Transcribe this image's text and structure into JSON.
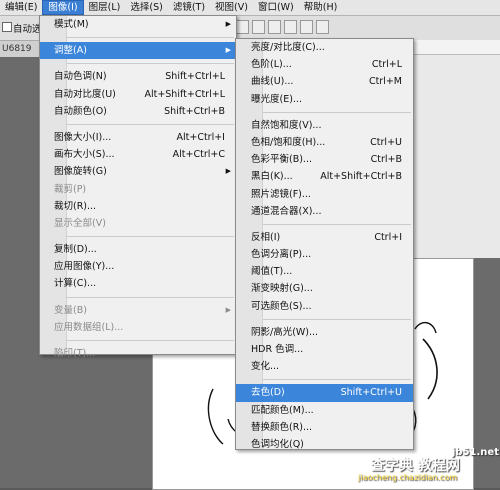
{
  "menubar": {
    "items": [
      "编辑(E)",
      "图像(I)",
      "图层(L)",
      "选择(S)",
      "滤镜(T)",
      "视图(V)",
      "窗口(W)",
      "帮助(H)"
    ],
    "active_index": 1
  },
  "options_bar": {
    "auto_select_label": "自动选"
  },
  "tab": {
    "doc_label": "U6819"
  },
  "image_menu": {
    "items": [
      {
        "type": "item",
        "label": "模式(M)",
        "arrow": true
      },
      {
        "type": "sep"
      },
      {
        "type": "item",
        "label": "调整(A)",
        "arrow": true,
        "highlighted": true
      },
      {
        "type": "sep"
      },
      {
        "type": "item",
        "label": "自动色调(N)",
        "shortcut": "Shift+Ctrl+L"
      },
      {
        "type": "item",
        "label": "自动对比度(U)",
        "shortcut": "Alt+Shift+Ctrl+L"
      },
      {
        "type": "item",
        "label": "自动颜色(O)",
        "shortcut": "Shift+Ctrl+B"
      },
      {
        "type": "sep"
      },
      {
        "type": "item",
        "label": "图像大小(I)...",
        "shortcut": "Alt+Ctrl+I"
      },
      {
        "type": "item",
        "label": "画布大小(S)...",
        "shortcut": "Alt+Ctrl+C"
      },
      {
        "type": "item",
        "label": "图像旋转(G)",
        "arrow": true
      },
      {
        "type": "item",
        "label": "裁剪(P)",
        "disabled": true
      },
      {
        "type": "item",
        "label": "裁切(R)..."
      },
      {
        "type": "item",
        "label": "显示全部(V)",
        "disabled": true
      },
      {
        "type": "sep"
      },
      {
        "type": "item",
        "label": "复制(D)..."
      },
      {
        "type": "item",
        "label": "应用图像(Y)..."
      },
      {
        "type": "item",
        "label": "计算(C)..."
      },
      {
        "type": "sep"
      },
      {
        "type": "item",
        "label": "变量(B)",
        "arrow": true,
        "disabled": true
      },
      {
        "type": "item",
        "label": "应用数据组(L)...",
        "disabled": true
      },
      {
        "type": "sep"
      },
      {
        "type": "item",
        "label": "陷印(T)...",
        "disabled": true
      }
    ]
  },
  "adjust_menu": {
    "items": [
      {
        "type": "item",
        "label": "亮度/对比度(C)..."
      },
      {
        "type": "item",
        "label": "色阶(L)...",
        "shortcut": "Ctrl+L"
      },
      {
        "type": "item",
        "label": "曲线(U)...",
        "shortcut": "Ctrl+M"
      },
      {
        "type": "item",
        "label": "曝光度(E)..."
      },
      {
        "type": "sep"
      },
      {
        "type": "item",
        "label": "自然饱和度(V)..."
      },
      {
        "type": "item",
        "label": "色相/饱和度(H)...",
        "shortcut": "Ctrl+U"
      },
      {
        "type": "item",
        "label": "色彩平衡(B)...",
        "shortcut": "Ctrl+B"
      },
      {
        "type": "item",
        "label": "黑白(K)...",
        "shortcut": "Alt+Shift+Ctrl+B"
      },
      {
        "type": "item",
        "label": "照片滤镜(F)..."
      },
      {
        "type": "item",
        "label": "通道混合器(X)..."
      },
      {
        "type": "sep"
      },
      {
        "type": "item",
        "label": "反相(I)",
        "shortcut": "Ctrl+I"
      },
      {
        "type": "item",
        "label": "色调分离(P)..."
      },
      {
        "type": "item",
        "label": "阈值(T)..."
      },
      {
        "type": "item",
        "label": "渐变映射(G)..."
      },
      {
        "type": "item",
        "label": "可选颜色(S)..."
      },
      {
        "type": "sep"
      },
      {
        "type": "item",
        "label": "阴影/高光(W)..."
      },
      {
        "type": "item",
        "label": "HDR 色调..."
      },
      {
        "type": "item",
        "label": "变化..."
      },
      {
        "type": "sep"
      },
      {
        "type": "item",
        "label": "去色(D)",
        "shortcut": "Shift+Ctrl+U",
        "highlighted": true
      },
      {
        "type": "item",
        "label": "匹配颜色(M)..."
      },
      {
        "type": "item",
        "label": "替换颜色(R)..."
      },
      {
        "type": "item",
        "label": "色调均化(Q)"
      }
    ]
  },
  "watermark": {
    "line1": "查字典 教程网",
    "line2": "jiaocheng.chazidian.com",
    "corner": "jb51.net"
  },
  "colors": {
    "highlight": "#3b85da",
    "menu_bg": "#f0f0f0",
    "disabled_text": "#8a8a8a"
  }
}
